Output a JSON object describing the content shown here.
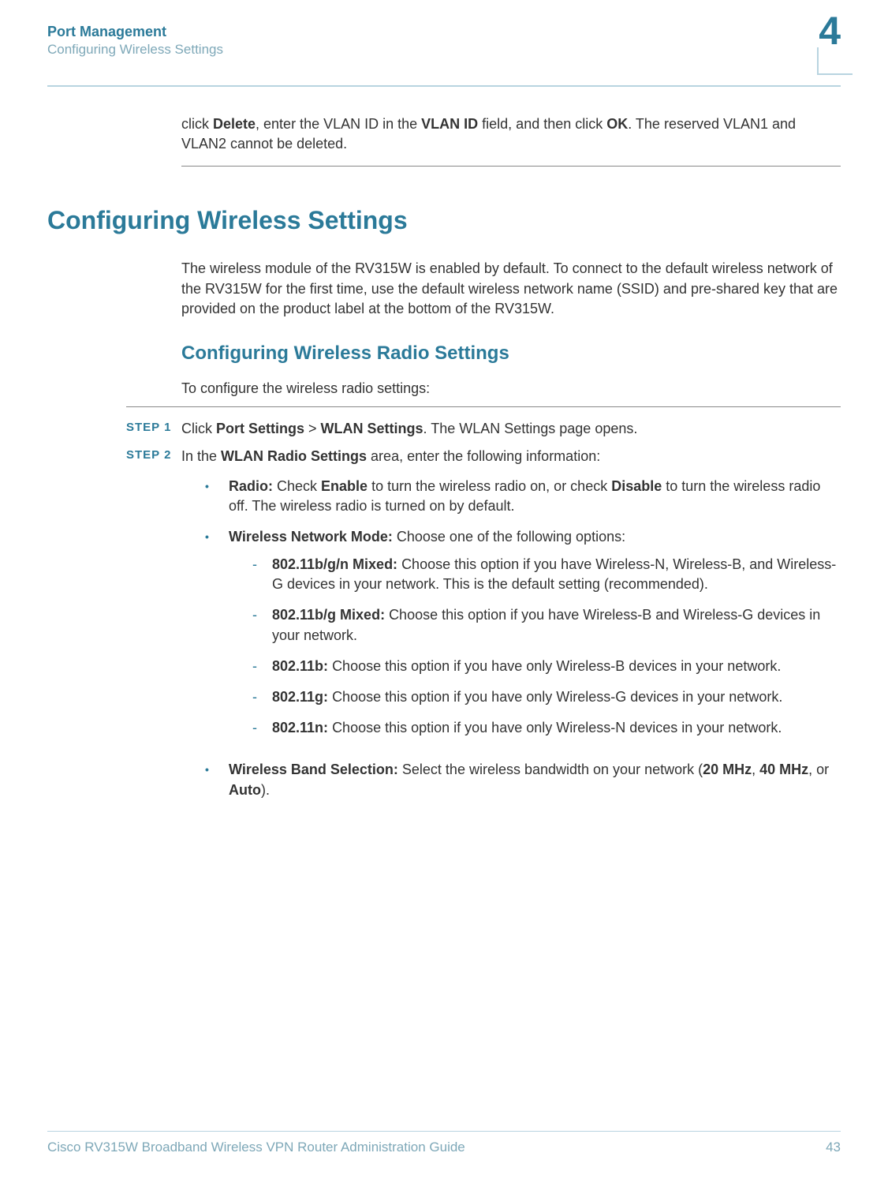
{
  "header": {
    "title": "Port Management",
    "subtitle": "Configuring Wireless Settings",
    "chapter": "4"
  },
  "intro_para_prefix": "click ",
  "intro_b1": "Delete",
  "intro_mid1": ", enter the VLAN ID in the ",
  "intro_b2": "VLAN ID",
  "intro_mid2": " field, and then click ",
  "intro_b3": "OK",
  "intro_suffix": ". The reserved VLAN1 and VLAN2 cannot be deleted.",
  "h1": "Configuring Wireless Settings",
  "wireless_intro": "The wireless module of the RV315W is enabled by default. To connect to the default wireless network of the RV315W for the first time, use the default wireless network name (SSID) and pre-shared key that are provided on the product label at the bottom of the RV315W.",
  "h2": "Configuring Wireless Radio Settings",
  "radio_intro": "To configure the wireless radio settings:",
  "step1": {
    "label": "STEP  1",
    "prefix": "Click ",
    "b1": "Port Settings",
    "gt": " > ",
    "b2": "WLAN Settings",
    "suffix": ". The WLAN Settings page opens."
  },
  "step2": {
    "label": "STEP  2",
    "prefix": "In the ",
    "b1": "WLAN Radio Settings",
    "suffix": " area, enter the following information:"
  },
  "radio": {
    "label": "Radio: ",
    "t1": "Check ",
    "b1": "Enable",
    "t2": " to turn the wireless radio on, or check ",
    "b2": "Disable",
    "t3": " to turn the wireless radio off. The wireless radio is turned on by default."
  },
  "mode": {
    "label": "Wireless Network Mode: ",
    "suffix": "Choose one of the following options:"
  },
  "modes": {
    "bgn": {
      "label": "802.11b/g/n Mixed: ",
      "text": "Choose this option if you have Wireless-N, Wireless-B, and Wireless-G devices in your network. This is the default setting (recommended)."
    },
    "bg": {
      "label": "802.11b/g Mixed: ",
      "text": "Choose this option if you have Wireless-B and Wireless-G devices in your network."
    },
    "b": {
      "label": "802.11b: ",
      "text": "Choose this option if you have only Wireless-B devices in your network."
    },
    "g": {
      "label": "802.11g: ",
      "text": "Choose this option if you have only Wireless-G devices in your network."
    },
    "n": {
      "label": "802.11n: ",
      "text": "Choose this option if you have only Wireless-N devices in your network."
    }
  },
  "band": {
    "label": "Wireless Band Selection: ",
    "t1": "Select the wireless bandwidth on your network (",
    "b1": "20 MHz",
    "t2": ", ",
    "b2": "40 MHz",
    "t3": ", or ",
    "b3": "Auto",
    "t4": ")."
  },
  "footer": {
    "guide": "Cisco RV315W Broadband Wireless VPN Router Administration Guide",
    "page": "43"
  }
}
